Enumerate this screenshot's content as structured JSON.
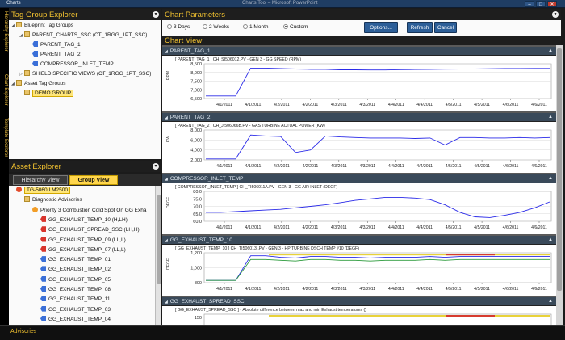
{
  "window": {
    "title": "Charts",
    "center_title": "Charts Tool – Microsoft PowerPoint",
    "controls": [
      "–",
      "□",
      "✕"
    ]
  },
  "side_tabs": [
    "Hierarchy Explorer",
    "Chart Explorer",
    "Template Explorer"
  ],
  "tag_group_explorer": {
    "title": "Tag Group Explorer",
    "tree": [
      {
        "label": "Blueprint Tag Groups",
        "icon": "folder",
        "level": 0,
        "expanded": true
      },
      {
        "label": "PARENT_CHARTS_SSC (CT_1RGG_1PT_SSC)",
        "icon": "folder",
        "level": 1,
        "expanded": true
      },
      {
        "label": "PARENT_TAG_1",
        "icon": "tag",
        "level": 2
      },
      {
        "label": "PARENT_TAG_2",
        "icon": "tag",
        "level": 2
      },
      {
        "label": "COMPRESSOR_INLET_TEMP",
        "icon": "tag",
        "level": 2
      },
      {
        "label": "SHIELD SPECIFIC VIEWS (CT_1RGG_1PT_SSC)",
        "icon": "folder",
        "level": 1,
        "expanded": false
      },
      {
        "label": "Asset Tag Groups",
        "icon": "folder",
        "level": 0,
        "expanded": true
      },
      {
        "label": "DEMO GROUP",
        "icon": "folder",
        "level": 1,
        "selected": true
      }
    ]
  },
  "asset_explorer": {
    "title": "Asset Explorer",
    "tabs": [
      {
        "label": "Hierarchy View",
        "active": false
      },
      {
        "label": "Group View",
        "active": true
      }
    ],
    "tree": [
      {
        "label": "TG-5060 LM2500",
        "icon": "asset",
        "level": 0,
        "selected": true
      },
      {
        "label": "Diagnostic Advisories",
        "icon": "folder",
        "level": 1
      },
      {
        "label": "Priority 3 Combustion Cold Spot On GG Exha",
        "icon": "warn",
        "level": 2
      },
      {
        "label": "GG_EXHAUST_TEMP_10 (H,LH)",
        "icon": "red",
        "level": 3
      },
      {
        "label": "GG_EXHAUST_SPREAD_SSC (LH,H)",
        "icon": "red",
        "level": 3
      },
      {
        "label": "GG_EXHAUST_TEMP_09 (LL,L)",
        "icon": "red",
        "level": 3
      },
      {
        "label": "GG_EXHAUST_TEMP_07 (LL,L)",
        "icon": "red",
        "level": 3
      },
      {
        "label": "GG_EXHAUST_TEMP_01",
        "icon": "tag",
        "level": 3
      },
      {
        "label": "GG_EXHAUST_TEMP_02",
        "icon": "tag",
        "level": 3
      },
      {
        "label": "GG_EXHAUST_TEMP_05",
        "icon": "tag",
        "level": 3
      },
      {
        "label": "GG_EXHAUST_TEMP_08",
        "icon": "tag",
        "level": 3
      },
      {
        "label": "GG_EXHAUST_TEMP_11",
        "icon": "tag",
        "level": 3
      },
      {
        "label": "GG_EXHAUST_TEMP_03",
        "icon": "tag",
        "level": 3
      },
      {
        "label": "GG_EXHAUST_TEMP_04",
        "icon": "tag",
        "level": 3
      }
    ]
  },
  "bottom_bar": {
    "label": "Advisories"
  },
  "chart_parameters": {
    "title": "Chart Parameters",
    "ranges": [
      {
        "label": "3 Days",
        "selected": false
      },
      {
        "label": "2 Weeks",
        "selected": false
      },
      {
        "label": "1 Month",
        "selected": false
      },
      {
        "label": "Custom",
        "selected": true
      }
    ],
    "buttons": {
      "options": "Options...",
      "refresh": "Refresh",
      "cancel": "Cancel"
    }
  },
  "chart_view": {
    "title": "Chart View"
  },
  "chart_data": [
    {
      "type": "line",
      "section": "PARENT_TAG_1",
      "title": "[ PARENT_TAG_1 ]  CH_SI506012.PV - GEN 3 - GG SPEED (RPM)",
      "ylabel": "RPM",
      "ylim": [
        6500,
        8500
      ],
      "yticks": [
        "8,500",
        "8,000",
        "7,500",
        "7,000",
        "6,500"
      ],
      "x_ticks": [
        "4/1/2011",
        "4/1/2011",
        "4/2/2011",
        "4/2/2011",
        "4/3/2011",
        "4/3/2011",
        "4/4/2011",
        "4/4/2011",
        "4/5/2011",
        "4/5/2011",
        "4/6/2011",
        "4/6/2011"
      ],
      "series": [
        {
          "color": "#2a2ae8",
          "values": [
            6650,
            6650,
            6650,
            8250,
            8250,
            8220,
            8200,
            8180,
            8180,
            8150,
            8150,
            8140,
            8140,
            8160,
            8170,
            8180,
            8190,
            8200,
            8200,
            8210,
            8220,
            8220,
            8230,
            8230
          ]
        }
      ]
    },
    {
      "type": "line",
      "section": "PARENT_TAG_2",
      "title": "[ PARENT_TAG_2 ]  CH_JI506066B.PV - GAS TURBINE ACTUAL POWER (KW)",
      "ylabel": "KW",
      "ylim": [
        2000,
        8000
      ],
      "yticks": [
        "8,000",
        "6,000",
        "4,000",
        "2,000"
      ],
      "x_ticks": [
        "4/1/2011",
        "4/1/2011",
        "4/2/2011",
        "4/2/2011",
        "4/3/2011",
        "4/3/2011",
        "4/4/2011",
        "4/4/2011",
        "4/5/2011",
        "4/5/2011",
        "4/6/2011",
        "4/6/2011"
      ],
      "series": [
        {
          "color": "#2a2ae8",
          "values": [
            2200,
            2200,
            2200,
            7000,
            6800,
            6700,
            3500,
            4000,
            6800,
            6600,
            6500,
            6400,
            6400,
            6400,
            6300,
            6400,
            5000,
            6500,
            6500,
            6400,
            6400,
            6500,
            6400,
            6500
          ]
        }
      ]
    },
    {
      "type": "line",
      "section": "COMPRESSOR_INLET_TEMP",
      "title": "[ COMPRESSOR_INLET_TEMP ]  CH_TI506011A.PV - GEN 3 - GG AIR INLET (DEGF)",
      "ylabel": "DEGF",
      "ylim": [
        60,
        80
      ],
      "yticks": [
        "80.0",
        "75.0",
        "70.0",
        "65.0",
        "60.0"
      ],
      "x_ticks": [
        "4/1/2011",
        "4/1/2011",
        "4/2/2011",
        "4/2/2011",
        "4/3/2011",
        "4/3/2011",
        "4/4/2011",
        "4/4/2011",
        "4/5/2011",
        "4/5/2011",
        "4/6/2011",
        "4/6/2011"
      ],
      "series": [
        {
          "color": "#2a2ae8",
          "values": [
            66,
            66,
            66.5,
            67,
            67.5,
            68,
            69,
            70,
            71,
            72.5,
            74,
            75,
            76,
            76,
            75.5,
            74.5,
            71,
            66,
            63,
            62.5,
            64,
            66,
            69,
            73
          ]
        }
      ]
    },
    {
      "type": "line",
      "section": "GG_EXHAUST_TEMP_10",
      "title": "[ GG_EXHAUST_TEMP_10 ]  CH_TI506013I.PV - GEN 3 - HP TURBINE DSCH TEMP #10 (DEGF)",
      "ylabel": "DEGF",
      "ylim": [
        800,
        1200
      ],
      "yticks": [
        "1,200",
        "1,000",
        "800"
      ],
      "x_ticks": [
        "4/1/2011",
        "4/1/2011",
        "4/2/2011",
        "4/2/2011",
        "4/3/2011",
        "4/3/2011",
        "4/4/2011",
        "4/4/2011",
        "4/5/2011",
        "4/5/2011",
        "4/6/2011",
        "4/6/2011"
      ],
      "series": [
        {
          "color": "#2a2ae8",
          "values": [
            830,
            830,
            830,
            1160,
            1160,
            1140,
            1130,
            1150,
            1150,
            1140,
            1140,
            1130,
            1140,
            1140,
            1140,
            1150,
            1140,
            1150,
            1150,
            1150,
            1150,
            1150,
            1150,
            1150
          ]
        },
        {
          "color": "#2a9a3a",
          "values": [
            830,
            830,
            830,
            1110,
            1110,
            1100,
            1090,
            1110,
            1110,
            1100,
            1100,
            1090,
            1100,
            1100,
            1100,
            1110,
            1100,
            1110,
            1110,
            1110,
            1110,
            1110,
            1110,
            1110
          ]
        }
      ]
    },
    {
      "type": "line",
      "section": "GG_EXHAUST_SPREAD_SSC",
      "title": "[ GG_EXHAUST_SPREAD_SSC ]  - Absolute difference between max and min Exhaust temperatures ()",
      "ylabel": "",
      "ylim": [
        0,
        200
      ],
      "yticks": [
        "150"
      ],
      "x_ticks": [],
      "series": []
    }
  ]
}
